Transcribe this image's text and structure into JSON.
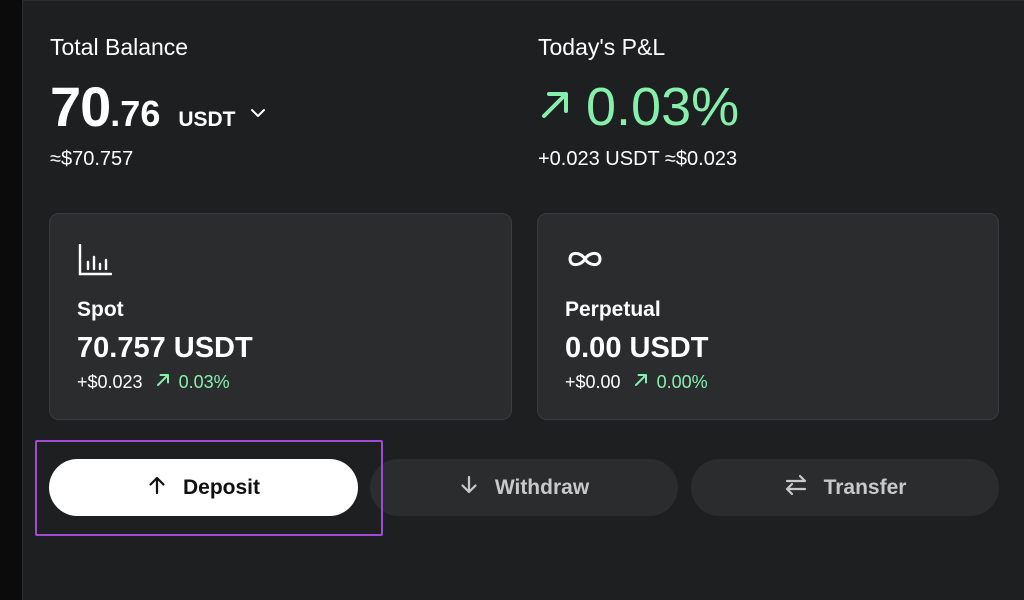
{
  "balance": {
    "label": "Total Balance",
    "integer": "70",
    "decimal": ".76",
    "unit": "USDT",
    "fiat_approx": "≈$70.757"
  },
  "pnl": {
    "label": "Today's P&L",
    "percent": "0.03%",
    "detail": "+0.023 USDT ≈$0.023"
  },
  "accounts": [
    {
      "icon": "bar-chart-icon",
      "name": "Spot",
      "amount": "70.757 USDT",
      "change": "+$0.023",
      "percent": "0.03%"
    },
    {
      "icon": "infinity-icon",
      "name": "Perpetual",
      "amount": "0.00 USDT",
      "change": "+$0.00",
      "percent": "0.00%"
    }
  ],
  "actions": {
    "deposit": "Deposit",
    "withdraw": "Withdraw",
    "transfer": "Transfer"
  },
  "colors": {
    "positive": "#86efac",
    "panel": "#1d1f21",
    "card": "#2a2c2e",
    "highlight": "#a349d8"
  }
}
